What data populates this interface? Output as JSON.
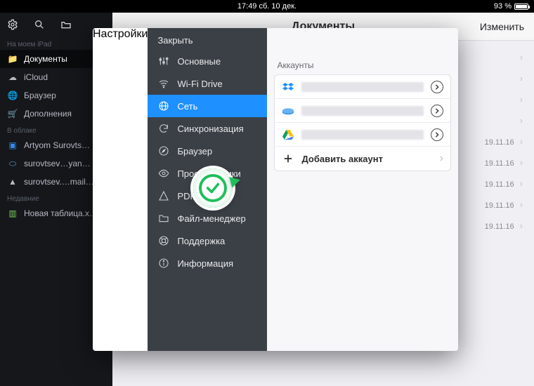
{
  "statusbar": {
    "clock": "17:49 сб. 10 дек.",
    "battery_pct": "93 %",
    "battery_fill": 93
  },
  "app": {
    "sections": {
      "device_hd": "На моем iPad",
      "device": [
        {
          "icon": "folder",
          "label": "Документы",
          "selected": true
        },
        {
          "icon": "cloud",
          "label": "iCloud"
        },
        {
          "icon": "globe",
          "label": "Браузер"
        },
        {
          "icon": "cart",
          "label": "Дополнения"
        }
      ],
      "cloud_hd": "В облаке",
      "cloud": [
        {
          "icon": "dropbox",
          "label": "Artyom Surovts…"
        },
        {
          "icon": "yandex",
          "label": "surovtsev…yan…"
        },
        {
          "icon": "gdrive",
          "label": "surovtsev.…mail…"
        }
      ],
      "recent_hd": "Недавние",
      "recent": [
        {
          "icon": "sheet",
          "label": "Новая таблица.х…"
        }
      ]
    },
    "title": "Документы",
    "edit": "Изменить",
    "rows": [
      {
        "date": ""
      },
      {
        "date": ""
      },
      {
        "date": ""
      },
      {
        "date": ""
      },
      {
        "date": "19.11.16"
      },
      {
        "date": "19.11.16"
      },
      {
        "date": "19.11.16"
      },
      {
        "date": "19.11.16"
      },
      {
        "date": "19.11.16"
      }
    ]
  },
  "settings": {
    "close": "Закрыть",
    "title": "Настройки",
    "items": [
      {
        "icon": "sliders",
        "label": "Основные"
      },
      {
        "icon": "wifi",
        "label": "Wi-Fi Drive"
      },
      {
        "icon": "globe",
        "label": "Сеть",
        "selected": true
      },
      {
        "icon": "sync",
        "label": "Синхронизация"
      },
      {
        "icon": "compass",
        "label": "Браузер"
      },
      {
        "icon": "eye",
        "label": "Просмотрщики"
      },
      {
        "icon": "pdf",
        "label": "PDF"
      },
      {
        "icon": "folder",
        "label": "Файл-менеджер"
      },
      {
        "icon": "support",
        "label": "Поддержка"
      },
      {
        "icon": "info",
        "label": "Информация"
      }
    ],
    "accounts_hd": "Аккаунты",
    "accounts": [
      {
        "service": "dropbox"
      },
      {
        "service": "yandex"
      },
      {
        "service": "gdrive"
      }
    ],
    "add_label": "Добавить аккаунт"
  },
  "colors": {
    "accent": "#1e90ff",
    "badge": "#1fbf5b"
  }
}
